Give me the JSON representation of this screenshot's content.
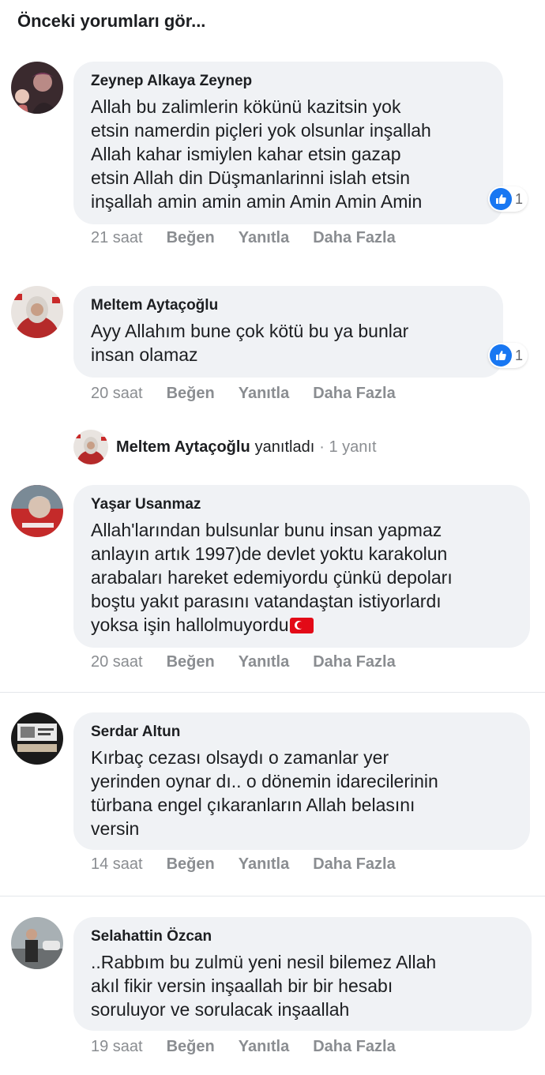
{
  "top_link": "Önceki yorumları gör...",
  "comments": [
    {
      "author": "Zeynep Alkaya Zeynep",
      "text": "Allah bu zalimlerin kökünü kazitsin yok\netsin namerdin piçleri yok olsunlar inşallah\nAllah kahar ismiylen kahar etsin gazap\netsin Allah din Düşmanlarinni islah etsin\ninşallah amin amin amin Amin Amin Amin",
      "reaction_count": "1",
      "time": "21 saat",
      "like": "Beğen",
      "reply": "Yanıtla",
      "more": "Daha Fazla"
    },
    {
      "author": "Meltem Aytaçoğlu",
      "text": "Ayy Allahım bune çok kötü bu ya bunlar\ninsan olamaz",
      "reaction_count": "1",
      "time": "20 saat",
      "like": "Beğen",
      "reply": "Yanıtla",
      "more": "Daha Fazla"
    },
    {
      "author": "Yaşar Usanmaz",
      "text": "Allah'larından bulsunlar bunu insan yapmaz\nanlayın artık 1997)de devlet yoktu karakolun\narabaları hareket edemiyordu çünkü depoları\nboştu yakıt parasını vatandaştan istiyorlardı\nyoksa işin hallolmuyordu",
      "time": "20 saat",
      "like": "Beğen",
      "reply": "Yanıtla",
      "more": "Daha Fazla"
    },
    {
      "author": "Serdar Altun",
      "text": "Kırbaç cezası olsaydı o zamanlar yer\nyerinden oynar dı.. o dönemin idarecilerinin\ntürbana engel çıkaranların Allah belasını\nversin",
      "time": "14 saat",
      "like": "Beğen",
      "reply": "Yanıtla",
      "more": "Daha Fazla"
    },
    {
      "author": "Selahattin Özcan",
      "text": "..Rabbım bu zulmü yeni nesil bilemez Allah\nakıl fikir versin inşaallah bir bir hesabı\nsoruluyor ve sorulacak inşaallah",
      "time": "19 saat",
      "like": "Beğen",
      "reply": "Yanıtla",
      "more": "Daha Fazla"
    }
  ],
  "replies_row": {
    "name": "Meltem Aytaçoğlu",
    "verb": "yanıtladı",
    "count": "· 1 yanıt"
  },
  "colors": {
    "bubble": "#f0f2f5",
    "like_blue": "#1877f2",
    "meta_gray": "#8a8d91"
  },
  "icons": [
    "like-icon",
    "turkish-flag-emoji"
  ]
}
